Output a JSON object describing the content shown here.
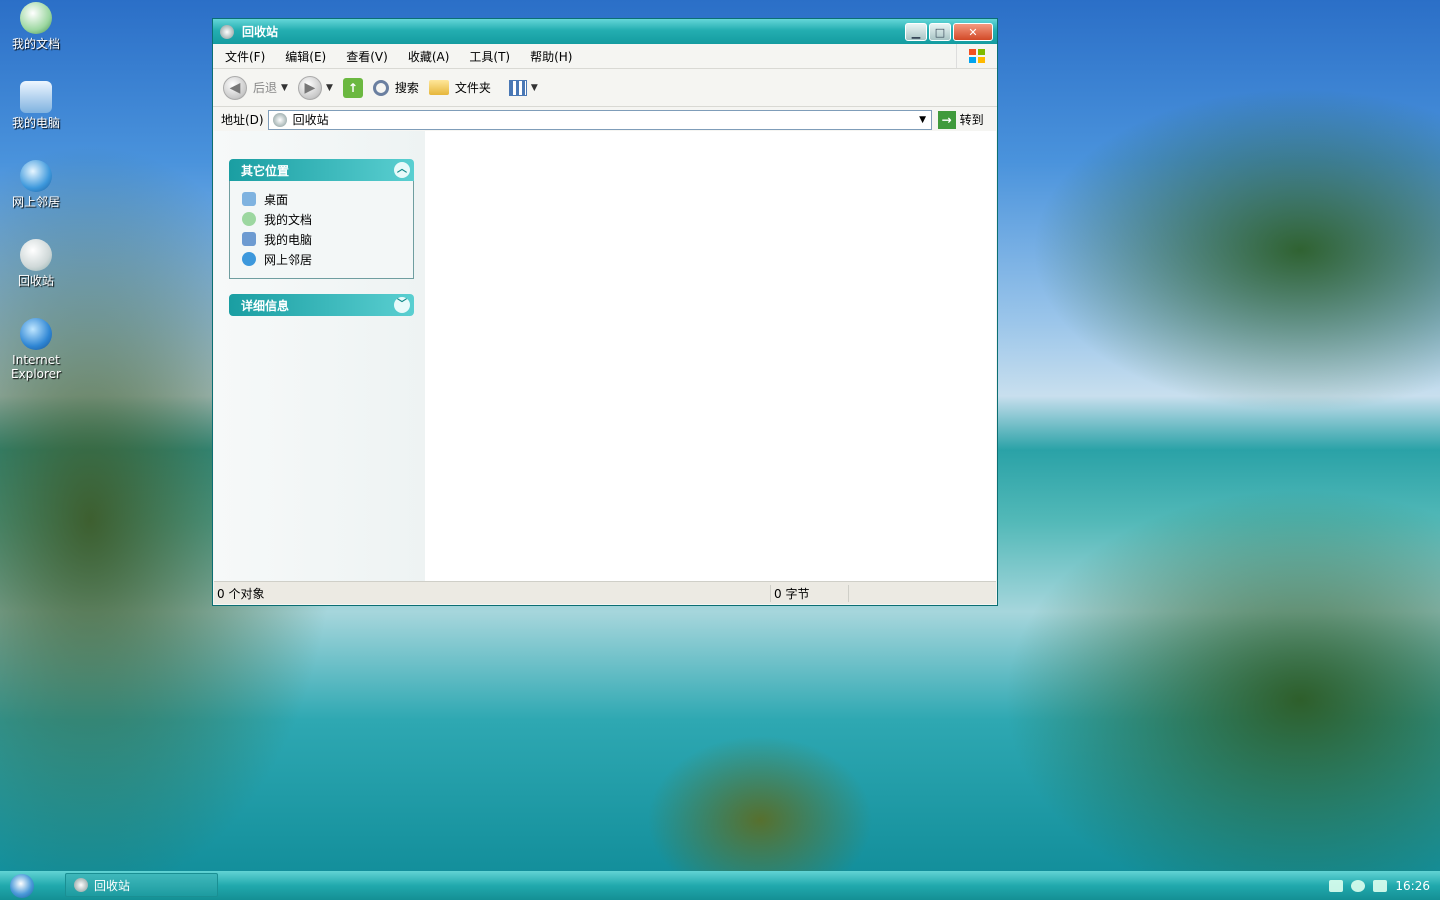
{
  "desktop": {
    "icons": [
      {
        "label": "我的文档"
      },
      {
        "label": "我的电脑"
      },
      {
        "label": "网上邻居"
      },
      {
        "label": "回收站"
      },
      {
        "label": "Internet Explorer"
      }
    ]
  },
  "window": {
    "title": "回收站",
    "menu": [
      "文件(F)",
      "编辑(E)",
      "查看(V)",
      "收藏(A)",
      "工具(T)",
      "帮助(H)"
    ],
    "toolbar": {
      "back": "后退",
      "search": "搜索",
      "folders": "文件夹"
    },
    "address": {
      "label": "地址(D)",
      "value": "回收站",
      "go": "转到"
    },
    "panels": {
      "other_places": {
        "title": "其它位置",
        "items": [
          "桌面",
          "我的文档",
          "我的电脑",
          "网上邻居"
        ]
      },
      "details": {
        "title": "详细信息"
      }
    },
    "status": {
      "objects": "0 个对象",
      "size": "0 字节"
    }
  },
  "taskbar": {
    "task": "回收站",
    "clock": "16:26"
  },
  "colors": {
    "accent": "#21a9ad",
    "title_text": "#ffffff"
  }
}
